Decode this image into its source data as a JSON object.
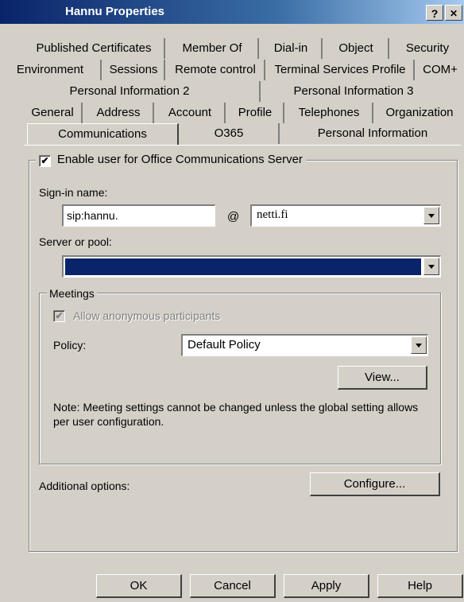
{
  "window": {
    "title": "Hannu Properties",
    "help_btn": "?",
    "close_btn": "✕"
  },
  "tabs": {
    "row1": [
      "Published Certificates",
      "Member Of",
      "Dial-in",
      "Object",
      "Security"
    ],
    "row2": [
      "Environment",
      "Sessions",
      "Remote control",
      "Terminal Services Profile",
      "COM+"
    ],
    "row3": [
      "Personal Information 2",
      "Personal Information 3"
    ],
    "row4": [
      "General",
      "Address",
      "Account",
      "Profile",
      "Telephones",
      "Organization"
    ],
    "row5": [
      "Communications",
      "O365",
      "Personal Information"
    ],
    "active": "Communications"
  },
  "ocs": {
    "enable_label": "Enable user for Office Communications Server",
    "enable_checked": "✔",
    "signin_label": "Sign-in name:",
    "signin_value": "sip:hannu.",
    "at_symbol": "@",
    "domain_value": "netti.fi",
    "server_label": "Server or pool:",
    "server_value": ""
  },
  "meetings": {
    "group_label": "Meetings",
    "anon_label": "Allow anonymous participants",
    "anon_checked": "✔",
    "policy_label": "Policy:",
    "policy_value": "Default Policy",
    "view_button": "View...",
    "note": "Note: Meeting settings cannot be changed unless the global setting allows per user configuration."
  },
  "additional": {
    "label": "Additional options:",
    "configure_button": "Configure..."
  },
  "footer": {
    "ok": "OK",
    "cancel": "Cancel",
    "apply": "Apply",
    "help": "Help"
  },
  "colors": {
    "face": "#d4d0c8",
    "titlebar": "#0a246a",
    "selection": "#0a246a"
  }
}
